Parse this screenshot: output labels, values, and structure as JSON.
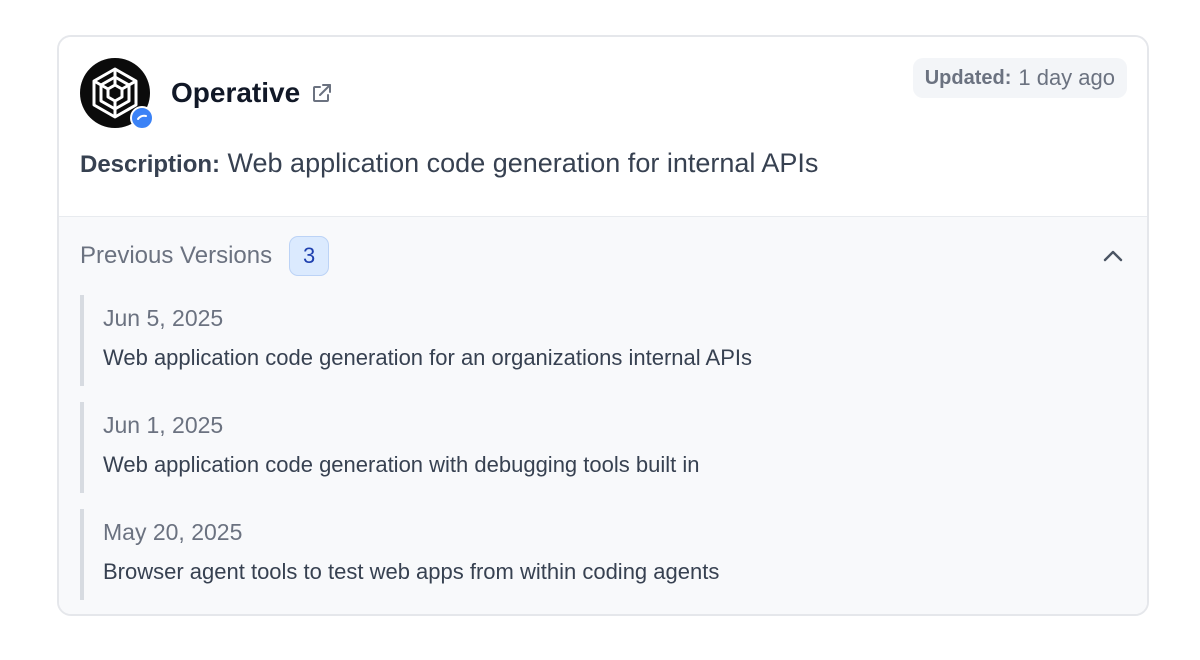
{
  "app": {
    "name": "Operative",
    "updated_label": "Updated:",
    "updated_value": "1 day ago",
    "description_label": "Description:",
    "description": "Web application code generation for internal APIs"
  },
  "icons": {
    "avatar": "operative-logo",
    "external_link": "external-link-icon",
    "verified": "verified-badge-icon",
    "chevron": "chevron-up-icon"
  },
  "versions": {
    "title": "Previous Versions",
    "count": "3",
    "items": [
      {
        "date": "Jun 5, 2025",
        "text": "Web application code generation for an organizations internal APIs"
      },
      {
        "date": "Jun 1, 2025",
        "text": "Web application code generation with debugging tools built in"
      },
      {
        "date": "May 20, 2025",
        "text": "Browser agent tools to test web apps from within coding agents"
      }
    ]
  },
  "colors": {
    "accent": "#3b82f6",
    "badge_bg": "#dbeafe",
    "badge_text": "#1e40af"
  }
}
